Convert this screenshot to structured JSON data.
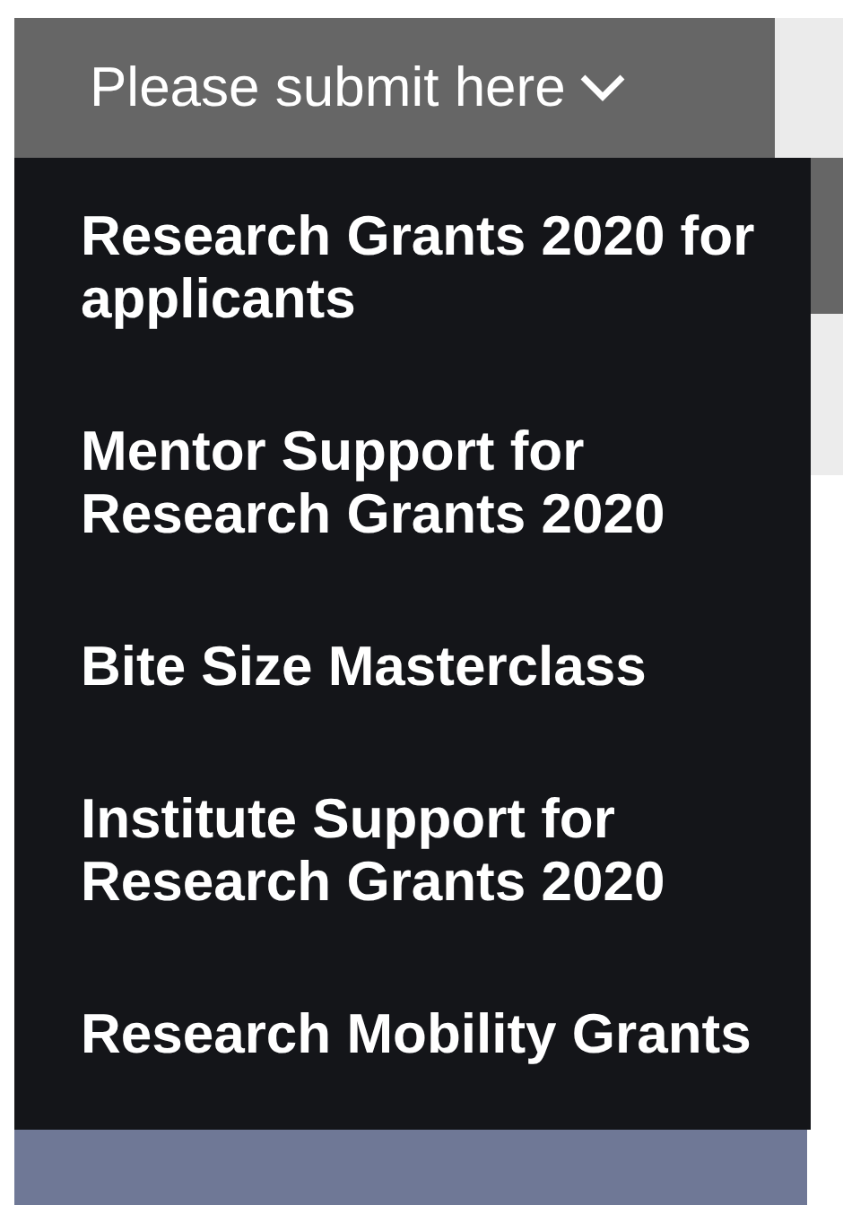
{
  "dropdown_button": {
    "label": "Please submit here"
  },
  "menu_items": [
    {
      "label": "Research Grants 2020 for applicants"
    },
    {
      "label": "Mentor Support for Research Grants 2020"
    },
    {
      "label": "Bite Size Masterclass"
    },
    {
      "label": "Institute Support for Research Grants 2020"
    },
    {
      "label": "Research Mobility Grants"
    }
  ]
}
